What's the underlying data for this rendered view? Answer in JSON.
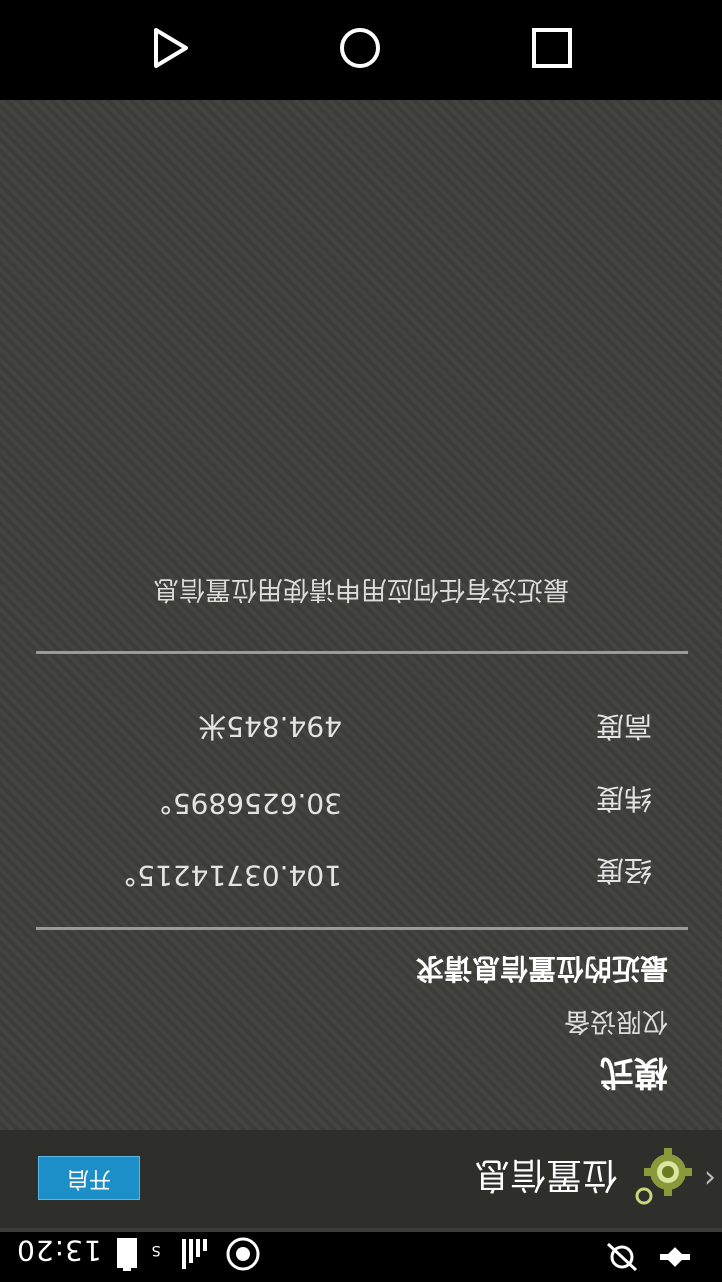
{
  "status_bar": {
    "time": "13:20",
    "signal_label": "S",
    "icons": [
      "sync-icon",
      "signal-icon",
      "battery-icon",
      "satellite-icon",
      "gps-icon"
    ]
  },
  "action_bar": {
    "back_glyph": "‹",
    "title": "位置信息",
    "toggle_label": "开启",
    "accent_color": "#1c8fc8"
  },
  "mode": {
    "title": "模式",
    "value": "仅限设备"
  },
  "recent_location": {
    "title": "最近的位置信息请求",
    "rows": [
      {
        "label": "经度",
        "value": "104.03714215°"
      },
      {
        "label": "纬度",
        "value": "30.6256895°"
      },
      {
        "label": "高度",
        "value": "494.845米"
      }
    ]
  },
  "recent_requests_text": "最近没有任何应用申请使用位置信息",
  "nav_bar": {
    "icons": [
      "recents-icon",
      "home-icon",
      "back-icon"
    ]
  }
}
